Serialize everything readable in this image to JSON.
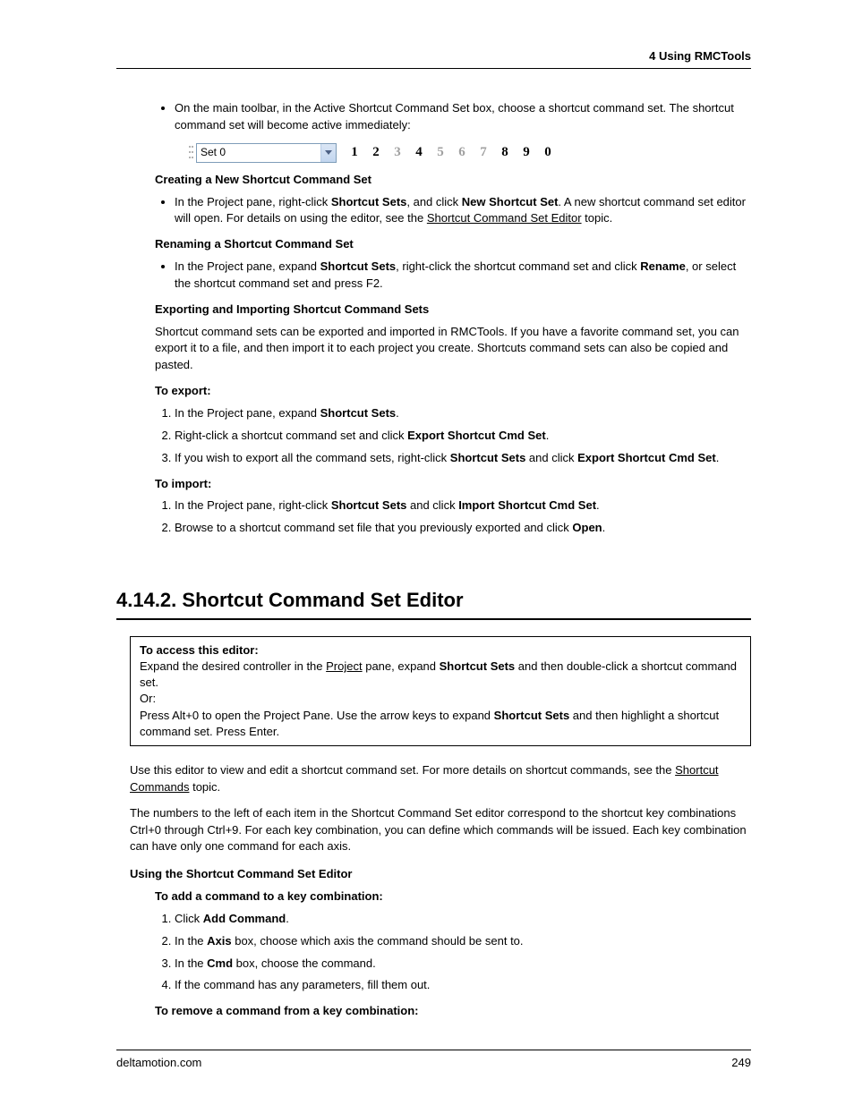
{
  "header": {
    "section": "4  Using RMCTools"
  },
  "intro": {
    "bullet1": "On the main toolbar, in the Active Shortcut Command Set box, choose a shortcut command set. The shortcut command set will become active immediately:"
  },
  "toolbar": {
    "dropdown_value": "Set 0",
    "nums": [
      {
        "n": "1",
        "dark": true
      },
      {
        "n": "2",
        "dark": true
      },
      {
        "n": "3",
        "dark": false
      },
      {
        "n": "4",
        "dark": true
      },
      {
        "n": "5",
        "dark": false
      },
      {
        "n": "6",
        "dark": false
      },
      {
        "n": "7",
        "dark": false
      },
      {
        "n": "8",
        "dark": true
      },
      {
        "n": "9",
        "dark": true
      },
      {
        "n": "0",
        "dark": true
      }
    ]
  },
  "sections": {
    "create_head": "Creating a New Shortcut Command Set",
    "create_bullet_pre": "In the Project pane, right-click ",
    "create_b1": "Shortcut Sets",
    "create_mid1": ", and click ",
    "create_b2": "New Shortcut Set",
    "create_post": ". A new shortcut command set editor will open. For details on using the editor, see the ",
    "create_link": "Shortcut Command Set Editor",
    "create_tail": " topic.",
    "rename_head": "Renaming a Shortcut Command Set",
    "rename_pre": "In the Project pane, expand ",
    "rename_b1": "Shortcut Sets",
    "rename_mid": ", right-click the shortcut command set and click ",
    "rename_b2": "Rename",
    "rename_post": ", or select the shortcut command set and press F2.",
    "expimp_head": "Exporting and Importing Shortcut Command Sets",
    "expimp_para": "Shortcut command sets can be exported and imported in RMCTools. If you have a favorite command set, you can export it to a file, and then import it to each project you create. Shortcuts command sets can also be copied and pasted.",
    "export_head": "To export:",
    "export_1_pre": "In the Project pane, expand ",
    "export_1_b": "Shortcut Sets",
    "export_1_post": ".",
    "export_2_pre": "Right-click a shortcut command set and click ",
    "export_2_b": "Export Shortcut Cmd Set",
    "export_2_post": ".",
    "export_3_pre": "If you wish to export all the command sets, right-click ",
    "export_3_b1": "Shortcut Sets",
    "export_3_mid": " and click ",
    "export_3_b2": "Export Shortcut Cmd Set",
    "export_3_post": ".",
    "import_head": "To import:",
    "import_1_pre": "In the Project pane, right-click ",
    "import_1_b1": "Shortcut Sets",
    "import_1_mid": " and click ",
    "import_1_b2": "Import Shortcut Cmd Set",
    "import_1_post": ".",
    "import_2_pre": "Browse to a shortcut command set file that you previously exported and click ",
    "import_2_b": "Open",
    "import_2_post": "."
  },
  "h2": "4.14.2. Shortcut Command Set Editor",
  "access": {
    "head": "To access this editor:",
    "l1_pre": "Expand the desired controller in the ",
    "l1_link": "Project",
    "l1_mid": " pane, expand ",
    "l1_b": "Shortcut Sets",
    "l1_post": " and then double-click a shortcut command set.",
    "or": "Or:",
    "l2_pre": "Press Alt+0 to open the Project Pane. Use the arrow keys to expand ",
    "l2_b": "Shortcut Sets",
    "l2_post": " and then highlight a shortcut command set. Press Enter."
  },
  "body": {
    "p1_pre": "Use this editor to view and edit a shortcut command set. For more details on shortcut commands, see the ",
    "p1_link": "Shortcut Commands",
    "p1_post": " topic.",
    "p2": "The numbers to the left of each item in the Shortcut Command Set editor correspond to the shortcut key combinations Ctrl+0 through Ctrl+9. For each key combination, you can define which commands will be issued. Each key combination can have only one command for each axis.",
    "using_head": "Using the Shortcut Command Set Editor",
    "add_head": "To add a command to a key combination:",
    "add_1_pre": "Click ",
    "add_1_b": "Add Command",
    "add_1_post": ".",
    "add_2_pre": "In the ",
    "add_2_b": "Axis",
    "add_2_post": " box, choose which axis the command should be sent to.",
    "add_3_pre": "In the ",
    "add_3_b": "Cmd",
    "add_3_post": " box, choose the command.",
    "add_4": "If the command has any parameters, fill them out.",
    "remove_head": "To remove a command from a key combination:"
  },
  "footer": {
    "site": "deltamotion.com",
    "page": "249"
  }
}
